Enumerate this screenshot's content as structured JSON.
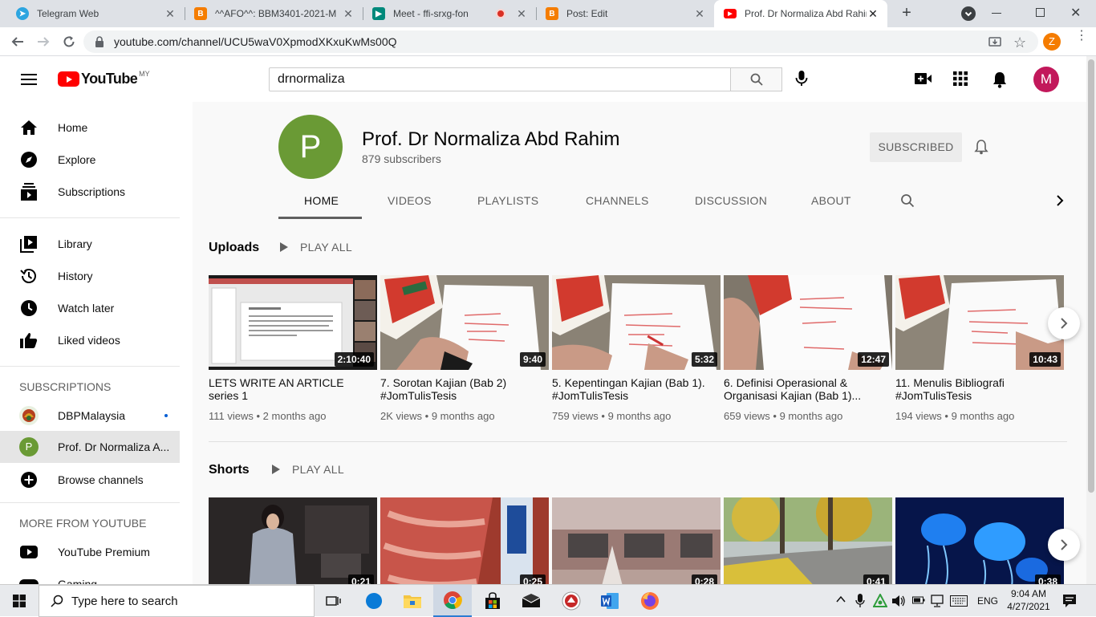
{
  "browser": {
    "tabs": [
      {
        "title": "Telegram Web",
        "icon": "telegram-icon",
        "color": "#2ca5e0"
      },
      {
        "title": "^^AFO^^: BBM3401-2021-M",
        "icon": "blogger-icon",
        "color": "#f57d00"
      },
      {
        "title": "Meet - ffi-srxg-fon",
        "icon": "meet-icon",
        "color": "#00897b"
      },
      {
        "title": "Post: Edit",
        "icon": "blogger-icon",
        "color": "#f57d00"
      },
      {
        "title": "Prof. Dr Normaliza Abd Rahim",
        "icon": "youtube-icon",
        "color": "#ff0000"
      }
    ],
    "url": "youtube.com/channel/UCU5waV0XpmodXKxuKwMs00Q",
    "profile_initial": "Z"
  },
  "youtube": {
    "logo_text": "YouTube",
    "region": "MY",
    "search_value": "drnormaliza",
    "avatar_initial": "M"
  },
  "sidebar": {
    "main": [
      "Home",
      "Explore",
      "Subscriptions"
    ],
    "library": [
      "Library",
      "History",
      "Watch later",
      "Liked videos"
    ],
    "subscriptions_heading": "SUBSCRIPTIONS",
    "subscriptions": [
      "DBPMalaysia",
      "Prof. Dr Normaliza A..."
    ],
    "browse": "Browse channels",
    "more_heading": "MORE FROM YOUTUBE",
    "more": [
      "YouTube Premium",
      "Gaming"
    ]
  },
  "channel": {
    "initial": "P",
    "name": "Prof. Dr Normaliza Abd Rahim",
    "subscribers": "879 subscribers",
    "subscribed_label": "SUBSCRIBED",
    "tabs": [
      "HOME",
      "VIDEOS",
      "PLAYLISTS",
      "CHANNELS",
      "DISCUSSION",
      "ABOUT"
    ]
  },
  "uploads": {
    "title": "Uploads",
    "play_all": "PLAY ALL",
    "videos": [
      {
        "title": "LETS WRITE AN ARTICLE series 1",
        "duration": "2:10:40",
        "views": "111 views",
        "age": "2 months ago"
      },
      {
        "title": "7. Sorotan Kajian (Bab 2) #JomTulisTesis",
        "duration": "9:40",
        "views": "2K views",
        "age": "9 months ago"
      },
      {
        "title": "5. Kepentingan Kajian (Bab 1). #JomTulisTesis",
        "duration": "5:32",
        "views": "759 views",
        "age": "9 months ago"
      },
      {
        "title": "6. Definisi Operasional & Organisasi Kajian (Bab 1)...",
        "duration": "12:47",
        "views": "659 views",
        "age": "9 months ago"
      },
      {
        "title": "11. Menulis Bibliografi #JomTulisTesis",
        "duration": "10:43",
        "views": "194 views",
        "age": "9 months ago"
      }
    ]
  },
  "shorts": {
    "title": "Shorts",
    "play_all": "PLAY ALL",
    "durations": [
      "0:21",
      "0:25",
      "0:28",
      "0:41",
      "0:38"
    ]
  },
  "taskbar": {
    "search_placeholder": "Type here to search",
    "language": "ENG",
    "time": "9:04 AM",
    "date": "4/27/2021"
  },
  "colors": {
    "channel_avatar": "#6a9a35",
    "user_avatar": "#c2185b",
    "youtube_red": "#ff0000"
  }
}
